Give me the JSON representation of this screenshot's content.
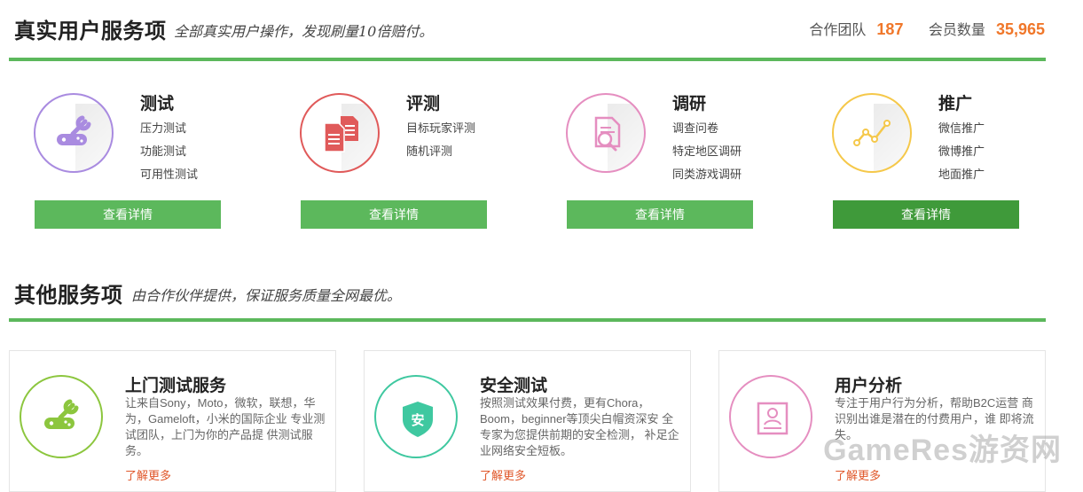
{
  "header": {
    "title": "真实用户服务项",
    "subtitle": "全部真实用户操作，发现刷量10倍赔付。",
    "team_label": "合作团队",
    "team_count": "187",
    "member_label": "会员数量",
    "member_count": "35,965"
  },
  "services": [
    {
      "name": "测试",
      "items": [
        "压力测试",
        "功能测试",
        "可用性测试"
      ],
      "button": "查看详情",
      "icon": "gamepad-wrench-icon",
      "color": "#a98be0"
    },
    {
      "name": "评测",
      "items": [
        "目标玩家评测",
        "随机评测"
      ],
      "button": "查看详情",
      "icon": "documents-icon",
      "color": "#e05a5a"
    },
    {
      "name": "调研",
      "items": [
        "调查问卷",
        "特定地区调研",
        "同类游戏调研"
      ],
      "button": "查看详情",
      "icon": "document-search-icon",
      "color": "#e58ec0"
    },
    {
      "name": "推广",
      "items": [
        "微信推广",
        "微博推广",
        "地面推广"
      ],
      "button": "查看详情",
      "icon": "trend-line-icon",
      "color": "#f5c84a"
    }
  ],
  "other": {
    "title": "其他服务项",
    "subtitle": "由合作伙伴提供，保证服务质量全网最优。"
  },
  "cards": [
    {
      "title": "上门测试服务",
      "desc": "让来自Sony，Moto，微软，联想，华为，Gameloft，小米的国际企业 专业测试团队，上门为你的产品提 供测试服务。",
      "more": "了解更多",
      "icon": "gamepad-wrench-icon",
      "color": "#8cc63e"
    },
    {
      "title": "安全测试",
      "desc": "按照测试效果付费，更有Chora，Boom，beginner等顶尖白帽资深安 全专家为您提供前期的安全检测， 补足企业网络安全短板。",
      "more": "了解更多",
      "icon": "shield-icon",
      "color": "#3fc8a0",
      "shield_text": "安"
    },
    {
      "title": "用户分析",
      "desc": "专注于用户行为分析，帮助B2C运营 商识别出谁是潜在的付费用户，谁 即将流失。",
      "more": "了解更多",
      "icon": "profile-card-icon",
      "color": "#e58ec0"
    }
  ],
  "watermark": "GameRes游资网"
}
